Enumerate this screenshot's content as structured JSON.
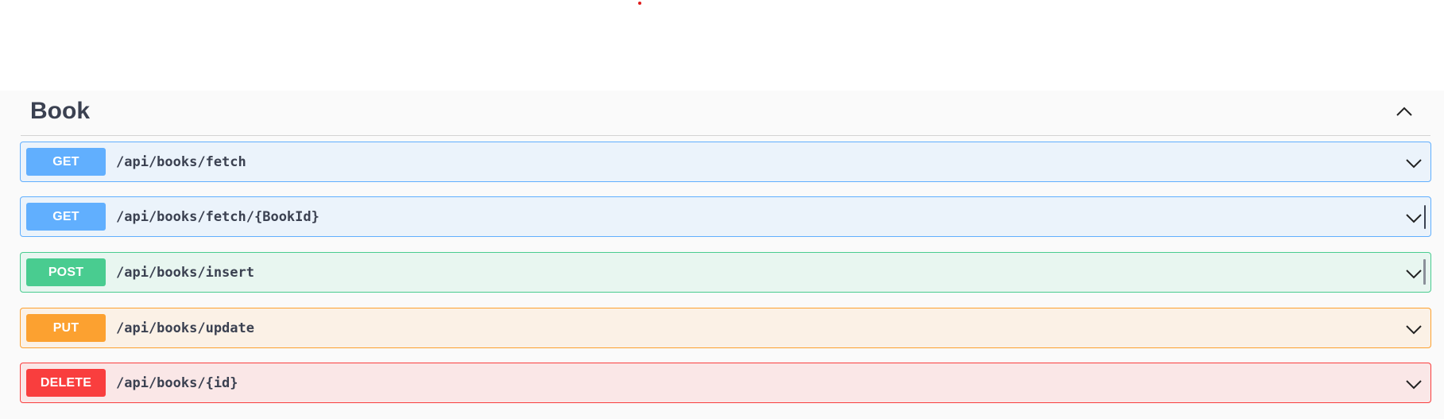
{
  "tag": {
    "title": "Book"
  },
  "operations": [
    {
      "method": "GET",
      "path": "/api/books/fetch",
      "color": "#61affe",
      "bg": "#ebf3fb"
    },
    {
      "method": "GET",
      "path": "/api/books/fetch/{BookId}",
      "color": "#61affe",
      "bg": "#ebf3fb"
    },
    {
      "method": "POST",
      "path": "/api/books/insert",
      "color": "#49cc90",
      "bg": "#e8f6f0"
    },
    {
      "method": "PUT",
      "path": "/api/books/update",
      "color": "#fca130",
      "bg": "#fbf1e6"
    },
    {
      "method": "DELETE",
      "path": "/api/books/{id}",
      "color": "#f93e3e",
      "bg": "#fae7e7"
    }
  ],
  "icons": {
    "tag_toggle": "chevron-up-icon",
    "op_toggle": "chevron-down-icon"
  }
}
